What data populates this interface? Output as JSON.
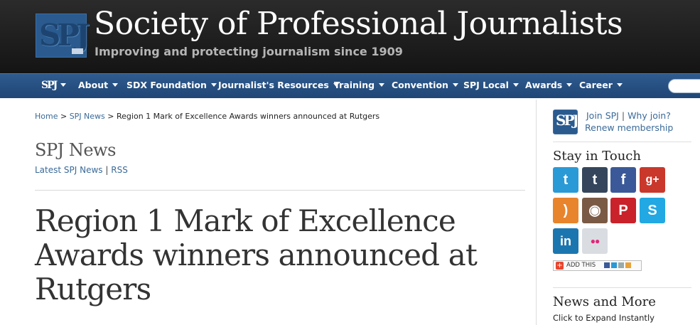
{
  "header": {
    "logo_text": "SPJ",
    "title": "Society of Professional Journalists",
    "tagline": "Improving and protecting journalism since 1909"
  },
  "nav": {
    "logo_text": "SPJ",
    "items": [
      {
        "label": "About"
      },
      {
        "label": "SDX Foundation"
      },
      {
        "label": "Journalist's Resources"
      },
      {
        "label": "Training"
      },
      {
        "label": "Convention"
      },
      {
        "label": "SPJ Local"
      },
      {
        "label": "Awards"
      },
      {
        "label": "Career"
      }
    ],
    "search_placeholder": ""
  },
  "breadcrumb": {
    "home": "Home",
    "sep1": ">",
    "section": "SPJ News",
    "sep2": ">",
    "current": "Region 1 Mark of Excellence Awards winners announced at Rutgers"
  },
  "section": {
    "title": "SPJ News",
    "link_latest": "Latest SPJ News",
    "sep": "|",
    "link_rss": "RSS"
  },
  "article": {
    "title": "Region 1 Mark of Excellence Awards winners announced at Rutgers"
  },
  "sidebar": {
    "logo_text": "SPJ",
    "join_label": "Join SPJ",
    "sep": "|",
    "why_label": "Why join?",
    "renew_label": "Renew membership",
    "stay_title": "Stay in Touch",
    "social": [
      {
        "name": "twitter",
        "glyph": "t",
        "color": "#2a9ad6"
      },
      {
        "name": "tumblr",
        "glyph": "t",
        "color": "#35465c"
      },
      {
        "name": "facebook",
        "glyph": "f",
        "color": "#3b5998"
      },
      {
        "name": "google-plus",
        "glyph": "g+",
        "color": "#c9382b"
      },
      {
        "name": "rss",
        "glyph": ")",
        "color": "#e8842c"
      },
      {
        "name": "instagram",
        "glyph": "◉",
        "color": "#7a5a45"
      },
      {
        "name": "pinterest",
        "glyph": "P",
        "color": "#c9222b"
      },
      {
        "name": "skype",
        "glyph": "S",
        "color": "#22a8e2"
      },
      {
        "name": "linkedin",
        "glyph": "in",
        "color": "#1b76b0"
      },
      {
        "name": "flickr",
        "glyph": "●●",
        "color": "#d9dde2"
      }
    ],
    "addthis_label": "ADD THIS",
    "news_title": "News and More",
    "news_sub": "Click to Expand Instantly"
  }
}
